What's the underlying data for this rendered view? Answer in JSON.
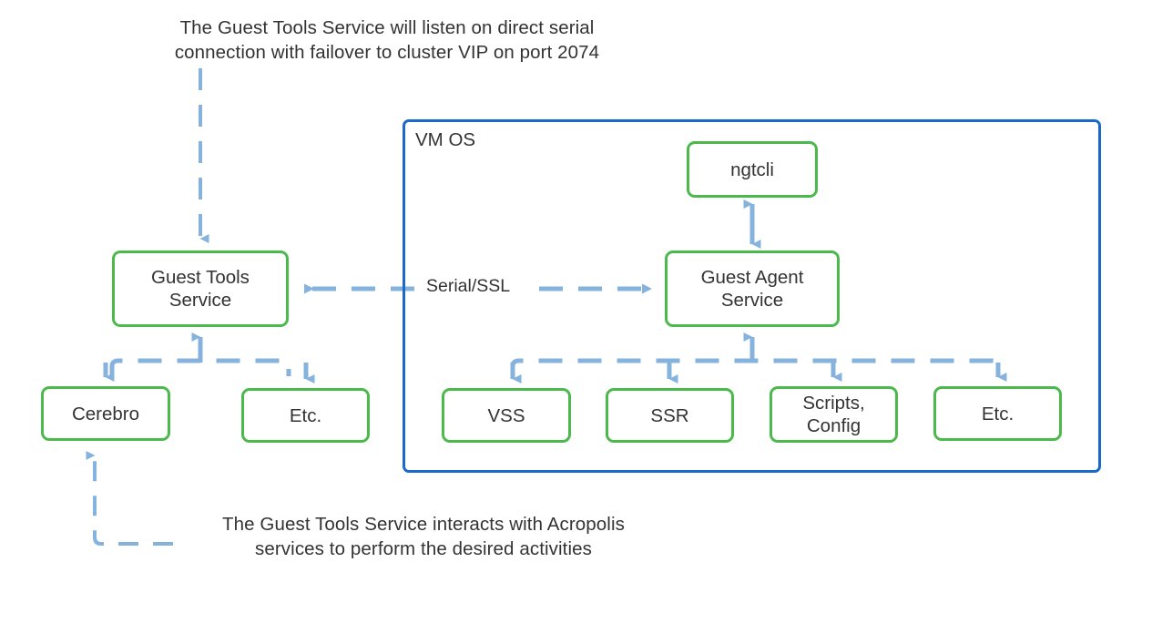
{
  "captions": {
    "top": "The Guest Tools Service will listen on direct serial\nconnection with failover to cluster VIP on port 2074",
    "bottom": "The Guest Tools Service interacts with Acropolis\nservices to perform the desired activities"
  },
  "container": {
    "label": "VM OS",
    "border_color": "#1b6ac9"
  },
  "nodes": {
    "guest_tools_service": "Guest Tools\nService",
    "cerebro": "Cerebro",
    "etc_left": "Etc.",
    "ngtcli": "ngtcli",
    "guest_agent_service": "Guest Agent\nService",
    "vss": "VSS",
    "ssr": "SSR",
    "scripts_config": "Scripts,\nConfig",
    "etc_right": "Etc."
  },
  "edges": {
    "serial_ssl_label": "Serial/SSL"
  },
  "colors": {
    "node_border": "#4cb94c",
    "container_border": "#1b6ac9",
    "connector": "#85b3dd",
    "text": "#333333",
    "background": "#ffffff"
  }
}
